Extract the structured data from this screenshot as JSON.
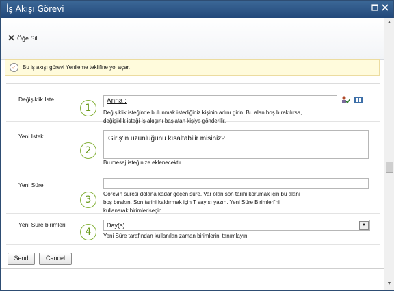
{
  "window": {
    "title": "İş Akışı Görevi"
  },
  "ribbon": {
    "delete_label": "Öğe Sil"
  },
  "notice": {
    "text": "Bu iş akışı görevi Yenileme teklifine yol açar."
  },
  "form": {
    "fields": [
      {
        "number": "1",
        "label": "Değişiklik İste",
        "value": "Anna ;",
        "description": [
          "Değişiklik isteğinde bulunmak istediğiniz kişinin adını girin. Bu alan boş bırakılırsa,",
          "değişiklik isteği İş akışını başlatan kişiye gönderilir."
        ]
      },
      {
        "number": "2",
        "label": "Yeni İstek",
        "value": "Giriş'in uzunluğunu kısaltabilir misiniz?",
        "description": [
          "Bu mesaj isteğinize eklenecektir."
        ]
      },
      {
        "number": "3",
        "label": "Yeni Süre",
        "value": "",
        "description": [
          "Görevin süresi dolana kadar geçen süre. Var olan son tarihi korumak için bu alanı",
          "boş bırakın. Son tarihi kaldırmak için T sayısı yazın. Yeni Süre Birimleri'ni",
          "kullanarak birimleriseçin."
        ]
      },
      {
        "number": "4",
        "label": "Yeni Süre birimleri",
        "value": "Day(s)",
        "description": [
          "Yeni Süre tarafından kullanılan zaman birimlerini tanımlayın."
        ]
      }
    ]
  },
  "buttons": {
    "send": "Send",
    "cancel": "Cancel"
  },
  "colors": {
    "titlebar": "#2b5283",
    "accent_circle": "#86b23b",
    "notice_bg": "#fffbdc"
  }
}
